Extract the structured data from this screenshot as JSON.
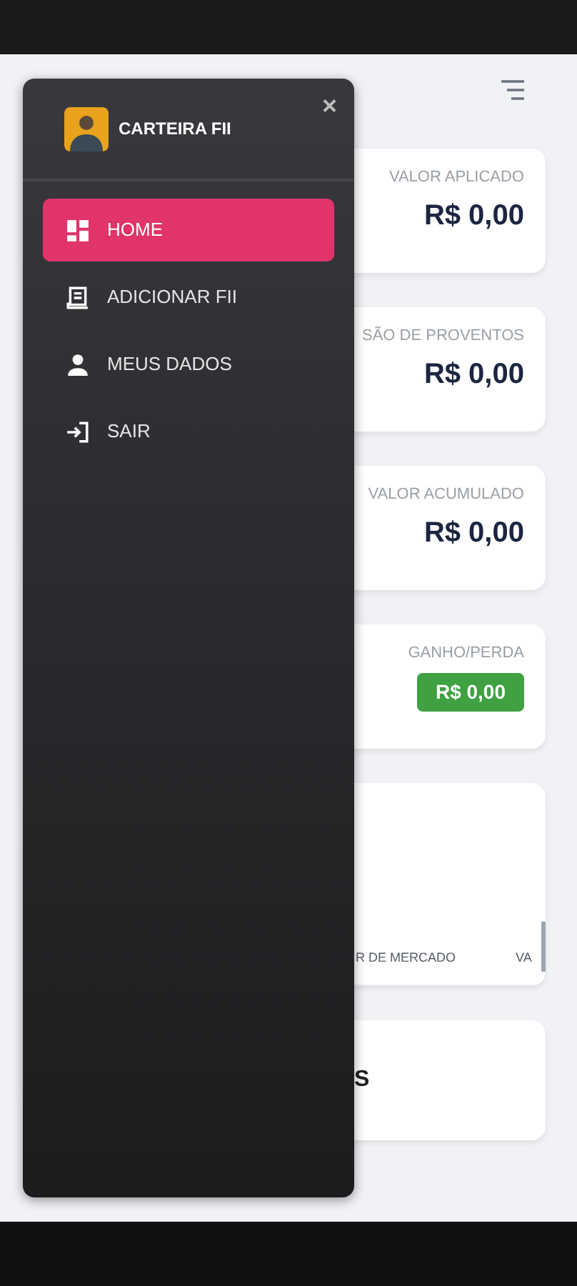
{
  "drawer": {
    "title": "CARTEIRA FII",
    "close": "×",
    "menu": [
      {
        "label": "HOME",
        "kind": "dashboard",
        "selected": true
      },
      {
        "label": "ADICIONAR FII",
        "kind": "add",
        "selected": false
      },
      {
        "label": "MEUS DADOS",
        "kind": "user",
        "selected": false
      },
      {
        "label": "SAIR",
        "kind": "logout",
        "selected": false
      }
    ]
  },
  "cards": [
    {
      "label": "VALOR APLICADO",
      "value": "R$ 0,00",
      "kind": "plain"
    },
    {
      "label": "SÃO DE PROVENTOS",
      "value": "R$ 0,00",
      "kind": "plain"
    },
    {
      "label": "VALOR ACUMULADO",
      "value": "R$ 0,00",
      "kind": "plain"
    },
    {
      "label": "GANHO/PERDA",
      "value": "R$ 0,00",
      "kind": "badge"
    }
  ],
  "table": {
    "columns": [
      "R DE MERCADO",
      "VA"
    ]
  },
  "last_card": {
    "text": "S"
  }
}
